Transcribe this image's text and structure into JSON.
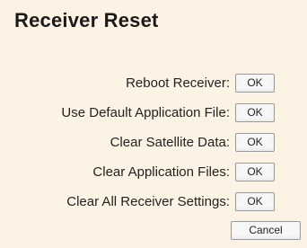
{
  "title": "Receiver Reset",
  "actions": [
    {
      "label": "Reboot Receiver:",
      "button": "OK"
    },
    {
      "label": "Use Default Application File:",
      "button": "OK"
    },
    {
      "label": "Clear Satellite Data:",
      "button": "OK"
    },
    {
      "label": "Clear Application Files:",
      "button": "OK"
    },
    {
      "label": "Clear All Receiver Settings:",
      "button": "OK"
    }
  ],
  "cancel_label": "Cancel",
  "colors": {
    "panel_background": "#fdf3e4",
    "text": "#222222",
    "button_border": "#9a9a9a"
  }
}
